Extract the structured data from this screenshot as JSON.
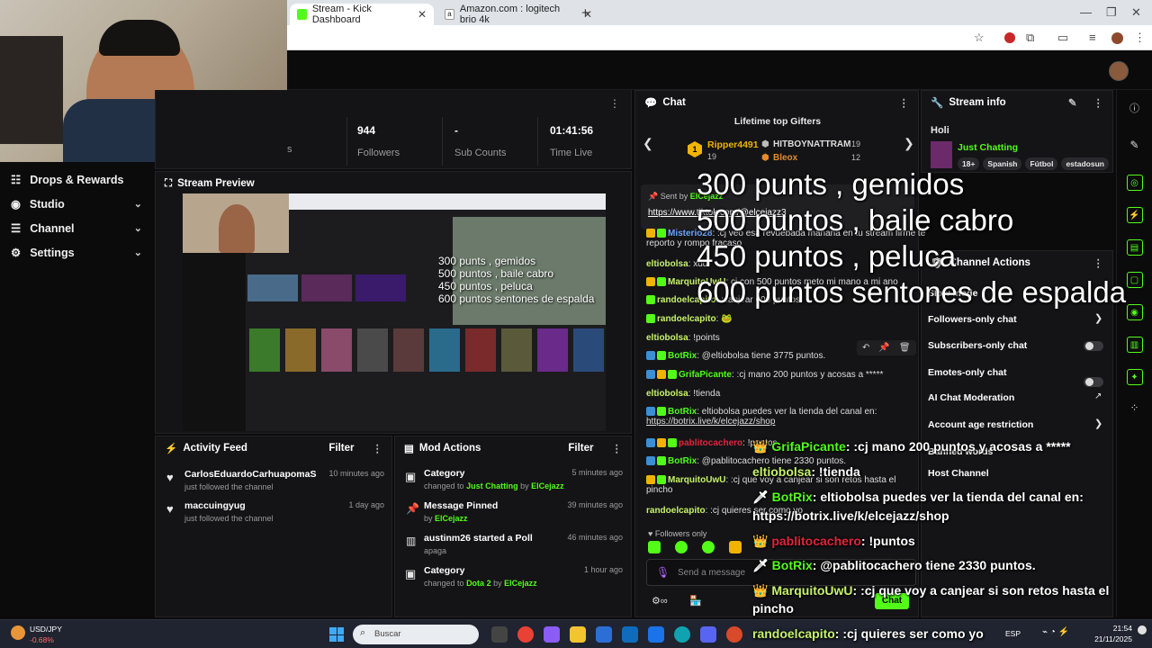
{
  "browser": {
    "tabs": [
      {
        "label": "Stream - Kick Dashboard",
        "active": true
      },
      {
        "label": "Amazon.com : logitech brio 4k",
        "active": false
      }
    ]
  },
  "sidebar": {
    "items": [
      {
        "label": "Drops & Rewards",
        "chevron": false
      },
      {
        "label": "Studio",
        "chevron": true
      },
      {
        "label": "Channel",
        "chevron": true
      },
      {
        "label": "Settings",
        "chevron": true
      }
    ]
  },
  "stats": [
    {
      "value": "944",
      "label": "Followers"
    },
    {
      "value": "-",
      "label": "Sub Counts"
    },
    {
      "value": "01:41:56",
      "label": "Time Live"
    }
  ],
  "stats_partial_label": "s",
  "preview": {
    "title": "Stream Preview",
    "overlay_lines": [
      "300 punts , gemidos",
      "500 puntos , baile cabro",
      "450 puntos , peluca",
      "600 puntos sentones de espalda"
    ]
  },
  "activity": {
    "title": "Activity Feed",
    "filter": "Filter",
    "items": [
      {
        "user": "CarlosEduardoCarhuapomaS",
        "action": "just followed the channel",
        "time": "10 minutes ago"
      },
      {
        "user": "maccuingyug",
        "action": "just followed the channel",
        "time": "1 day ago"
      }
    ]
  },
  "mod": {
    "title": "Mod Actions",
    "filter": "Filter",
    "items": [
      {
        "title": "Category",
        "pre": "changed to",
        "a": "Just Chatting",
        "mid": "by",
        "b": "ElCejazz",
        "time": "5 minutes ago"
      },
      {
        "title": "Message Pinned",
        "pre": "by",
        "a": "ElCejazz",
        "mid": "",
        "b": "",
        "time": "39 minutes ago"
      },
      {
        "title": "austinm26 started a Poll",
        "pre": "apaga",
        "a": "",
        "mid": "",
        "b": "",
        "time": "46 minutes ago"
      },
      {
        "title": "Category",
        "pre": "changed to",
        "a": "Dota 2",
        "mid": "by",
        "b": "ElCejazz",
        "time": "1 hour ago"
      }
    ]
  },
  "chat": {
    "title": "Chat",
    "gifters_title": "Lifetime top Gifters",
    "gifters": [
      {
        "name": "Ripper4491",
        "count": "19"
      },
      {
        "name": "HITBOYNATTRAM",
        "count": "19"
      },
      {
        "name": "Bleox",
        "count": "12"
      }
    ],
    "pinned_by": "Sent by",
    "pinned_user": "ElCejazz",
    "pinned_text": "https://www.tiktok.com/@elcejazz3",
    "messages": [
      {
        "user": "Misterio28",
        "text": ":cj veo esa revuebada mañana en tu stream firme te",
        "cont": "reporto y rompo fracaso"
      },
      {
        "user": "eltiobolsa",
        "text": "xdd",
        "cont": ""
      },
      {
        "user": "MarquitoUwU",
        "text": "cj con 500 puntos meto mi mano a mi ano",
        "cont": ""
      },
      {
        "user": "randoelcapito",
        "text": ":canjear 600 puntos",
        "cont": ""
      },
      {
        "user": "randoelcapito",
        "text": "🐸",
        "cont": ""
      },
      {
        "user": "eltiobolsa",
        "text": "!points",
        "cont": ""
      },
      {
        "user": "BotRix",
        "text": "@eltiobolsa tiene 3775 puntos.",
        "cont": ""
      },
      {
        "user": "GrifaPicante",
        "text": ":cj mano 200 puntos y acosas a *****",
        "cont": ""
      },
      {
        "user": "eltiobolsa",
        "text": "!tienda",
        "cont": ""
      },
      {
        "user": "BotRix",
        "text": "eltiobolsa puedes ver la tienda del canal en:",
        "cont": "https://botrix.live/k/elcejazz/shop"
      },
      {
        "user": "pablitocachero",
        "text": "!puntos",
        "cont": ""
      },
      {
        "user": "BotRix",
        "text": "@pablitocachero tiene 2330 puntos.",
        "cont": ""
      },
      {
        "user": "MarquitoUwU",
        "text": ":cj que voy a canjear si son retos hasta el",
        "cont": "pincho"
      },
      {
        "user": "randoelcapito",
        "text": ":cj quieres ser como yo",
        "cont": ""
      }
    ],
    "followers_only": "Followers only",
    "input_placeholder": "Send a message",
    "send_label": "Chat"
  },
  "stream_info": {
    "title": "Stream info",
    "stream_title": "Holi",
    "category": "Just Chatting",
    "tags": [
      "18+",
      "Spanish",
      "Fútbol",
      "estadosun"
    ]
  },
  "channel_actions": {
    "title": "Channel Actions",
    "items": [
      "Slow mode",
      "Followers-only chat",
      "Subscribers-only chat",
      "Emotes-only chat",
      "AI Chat Moderation",
      "Account age restriction",
      "Banned words",
      "Host Channel"
    ]
  },
  "overlay": {
    "big_lines": [
      "300 punts , gemidos",
      "500 puntos , baile cabro",
      "450 puntos , peluca",
      "600 puntos sentones de espalda"
    ],
    "chat_lines": [
      {
        "user": "GrifaPicante",
        "text": ":cj mano 200 puntos y acosas a *****"
      },
      {
        "user": "eltiobolsa",
        "text": "!tienda"
      },
      {
        "user": "BotRix",
        "text": "eltiobolsa puedes ver la tienda del canal en:"
      },
      {
        "user": "",
        "text": "https://botrix.live/k/elcejazz/shop"
      },
      {
        "user": "pablitocachero",
        "text": "!puntos"
      },
      {
        "user": "BotRix",
        "text": "@pablitocachero tiene 2330 puntos."
      },
      {
        "user": "MarquitoUwU",
        "text": ":cj que voy a canjear si son retos hasta el"
      },
      {
        "user": "",
        "text": "pincho"
      },
      {
        "user": "randoelcapito",
        "text": ":cj quieres ser como yo"
      }
    ]
  },
  "taskbar": {
    "ticker_name": "USD/JPY",
    "ticker_change": "-0.68%",
    "search_placeholder": "Buscar",
    "lang": "ESP",
    "time": "21:54",
    "date": "21/11/2025"
  },
  "colors": {
    "kick_green": "#53fc18",
    "bg": "#0b0b0c",
    "panel": "#141416"
  }
}
